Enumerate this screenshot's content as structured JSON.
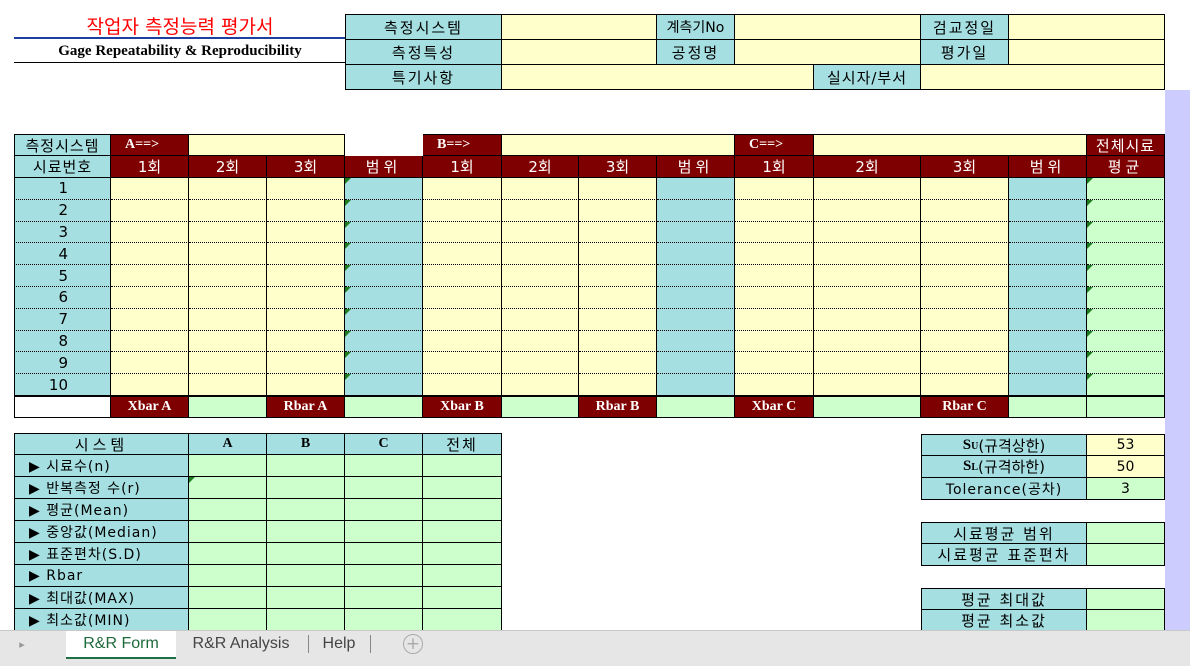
{
  "header": {
    "title_kr": "작업자 측정능력 평가서",
    "title_en": "Gage Repeatability & Reproducibility",
    "system_label": "측정시스템",
    "gauge_no_label": "계측기No",
    "calib_date_label": "검교정일",
    "characteristic_label": "측정특성",
    "process_label": "공정명",
    "eval_date_label": "평가일",
    "remarks_label": "특기사항",
    "performer_label": "실시자/부서"
  },
  "grid": {
    "system_label": "측정시스템",
    "sample_no_label": "시료번호",
    "op_a": "A==>",
    "op_b": "B==>",
    "op_c": "C==>",
    "total_sample": "전체시료",
    "trial1": "1회",
    "trial2": "2회",
    "trial3": "3회",
    "range": "범위",
    "average": "평균",
    "rows": [
      "1",
      "2",
      "3",
      "4",
      "5",
      "6",
      "7",
      "8",
      "9",
      "10"
    ],
    "xbar_a": "Xbar A",
    "rbar_a": "Rbar A",
    "xbar_b": "Xbar B",
    "rbar_b": "Rbar B",
    "xbar_c": "Xbar C",
    "rbar_c": "Rbar C"
  },
  "stats": {
    "header": "시스템",
    "col_a": "A",
    "col_b": "B",
    "col_c": "C",
    "col_total": "전체",
    "rows": [
      "▶ 시료수(n)",
      "▶ 반복측정 수(r)",
      "▶ 평균(Mean)",
      "▶ 중앙값(Median)",
      "▶ 표준편차(S.D)",
      "▶ Rbar",
      "▶ 최대값(MAX)",
      "▶ 최소값(MIN)"
    ]
  },
  "spec": {
    "su_label_bold": "SU",
    "su_label": "(규격상한)",
    "su_value": "53",
    "sl_label_bold": "SL",
    "sl_label": "(규격하한)",
    "sl_value": "50",
    "tol_label": "Tolerance(공차)",
    "tol_value": "3",
    "sample_avg_range": "시료평균 범위",
    "sample_avg_sd": "시료평균 표준편차",
    "avg_max": "평균 최대값",
    "avg_min": "평균 최소값"
  },
  "tabs": {
    "active": "R&R Form",
    "second": "R&R Analysis",
    "third": "Help"
  },
  "colors": {
    "header_cyan": "#a6dfe1",
    "input_yellow": "#ffffcc",
    "output_green": "#ccffcc",
    "header_red": "#7f0000",
    "title_red": "#ff0000",
    "violet_band": "#ccccff"
  }
}
